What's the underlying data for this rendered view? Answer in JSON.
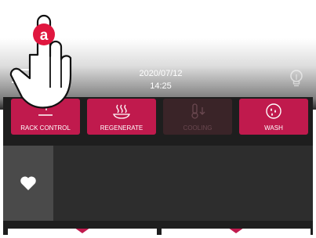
{
  "header": {
    "date": "2020/07/12",
    "time": "14:25",
    "menu_icon": "hamburger-menu-icon",
    "light_icon": "lightbulb-icon"
  },
  "buttons": [
    {
      "label": "RACK CONTROL",
      "icon": "rack-icon",
      "enabled": true
    },
    {
      "label": "REGENERATE",
      "icon": "steam-plate-icon",
      "enabled": true
    },
    {
      "label": "COOLING",
      "icon": "thermometer-down-icon",
      "enabled": false
    },
    {
      "label": "WASH",
      "icon": "wash-droplets-icon",
      "enabled": true
    }
  ],
  "favorites": {
    "icon": "heart-icon"
  },
  "overlay": {
    "badge_letter": "a",
    "badge_color": "#e0173f"
  },
  "colors": {
    "accent": "#c01a4d",
    "panel": "#1e1e1e",
    "favorites_bg": "#2d2d2d"
  }
}
